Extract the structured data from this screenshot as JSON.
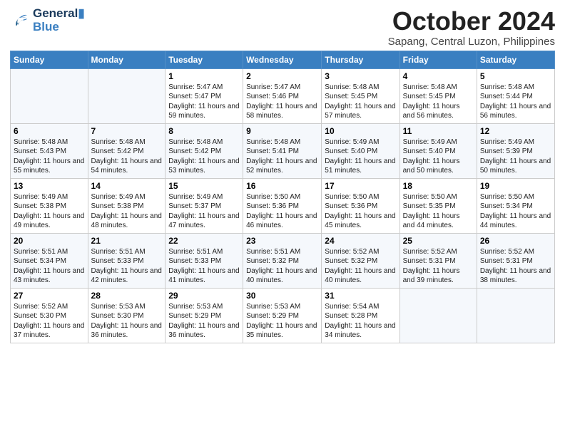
{
  "logo": {
    "line1": "General",
    "line2": "Blue"
  },
  "title": "October 2024",
  "subtitle": "Sapang, Central Luzon, Philippines",
  "headers": [
    "Sunday",
    "Monday",
    "Tuesday",
    "Wednesday",
    "Thursday",
    "Friday",
    "Saturday"
  ],
  "weeks": [
    [
      {
        "day": "",
        "sunrise": "",
        "sunset": "",
        "daylight": ""
      },
      {
        "day": "",
        "sunrise": "",
        "sunset": "",
        "daylight": ""
      },
      {
        "day": "1",
        "sunrise": "Sunrise: 5:47 AM",
        "sunset": "Sunset: 5:47 PM",
        "daylight": "Daylight: 11 hours and 59 minutes."
      },
      {
        "day": "2",
        "sunrise": "Sunrise: 5:47 AM",
        "sunset": "Sunset: 5:46 PM",
        "daylight": "Daylight: 11 hours and 58 minutes."
      },
      {
        "day": "3",
        "sunrise": "Sunrise: 5:48 AM",
        "sunset": "Sunset: 5:45 PM",
        "daylight": "Daylight: 11 hours and 57 minutes."
      },
      {
        "day": "4",
        "sunrise": "Sunrise: 5:48 AM",
        "sunset": "Sunset: 5:45 PM",
        "daylight": "Daylight: 11 hours and 56 minutes."
      },
      {
        "day": "5",
        "sunrise": "Sunrise: 5:48 AM",
        "sunset": "Sunset: 5:44 PM",
        "daylight": "Daylight: 11 hours and 56 minutes."
      }
    ],
    [
      {
        "day": "6",
        "sunrise": "Sunrise: 5:48 AM",
        "sunset": "Sunset: 5:43 PM",
        "daylight": "Daylight: 11 hours and 55 minutes."
      },
      {
        "day": "7",
        "sunrise": "Sunrise: 5:48 AM",
        "sunset": "Sunset: 5:42 PM",
        "daylight": "Daylight: 11 hours and 54 minutes."
      },
      {
        "day": "8",
        "sunrise": "Sunrise: 5:48 AM",
        "sunset": "Sunset: 5:42 PM",
        "daylight": "Daylight: 11 hours and 53 minutes."
      },
      {
        "day": "9",
        "sunrise": "Sunrise: 5:48 AM",
        "sunset": "Sunset: 5:41 PM",
        "daylight": "Daylight: 11 hours and 52 minutes."
      },
      {
        "day": "10",
        "sunrise": "Sunrise: 5:49 AM",
        "sunset": "Sunset: 5:40 PM",
        "daylight": "Daylight: 11 hours and 51 minutes."
      },
      {
        "day": "11",
        "sunrise": "Sunrise: 5:49 AM",
        "sunset": "Sunset: 5:40 PM",
        "daylight": "Daylight: 11 hours and 50 minutes."
      },
      {
        "day": "12",
        "sunrise": "Sunrise: 5:49 AM",
        "sunset": "Sunset: 5:39 PM",
        "daylight": "Daylight: 11 hours and 50 minutes."
      }
    ],
    [
      {
        "day": "13",
        "sunrise": "Sunrise: 5:49 AM",
        "sunset": "Sunset: 5:38 PM",
        "daylight": "Daylight: 11 hours and 49 minutes."
      },
      {
        "day": "14",
        "sunrise": "Sunrise: 5:49 AM",
        "sunset": "Sunset: 5:38 PM",
        "daylight": "Daylight: 11 hours and 48 minutes."
      },
      {
        "day": "15",
        "sunrise": "Sunrise: 5:49 AM",
        "sunset": "Sunset: 5:37 PM",
        "daylight": "Daylight: 11 hours and 47 minutes."
      },
      {
        "day": "16",
        "sunrise": "Sunrise: 5:50 AM",
        "sunset": "Sunset: 5:36 PM",
        "daylight": "Daylight: 11 hours and 46 minutes."
      },
      {
        "day": "17",
        "sunrise": "Sunrise: 5:50 AM",
        "sunset": "Sunset: 5:36 PM",
        "daylight": "Daylight: 11 hours and 45 minutes."
      },
      {
        "day": "18",
        "sunrise": "Sunrise: 5:50 AM",
        "sunset": "Sunset: 5:35 PM",
        "daylight": "Daylight: 11 hours and 44 minutes."
      },
      {
        "day": "19",
        "sunrise": "Sunrise: 5:50 AM",
        "sunset": "Sunset: 5:34 PM",
        "daylight": "Daylight: 11 hours and 44 minutes."
      }
    ],
    [
      {
        "day": "20",
        "sunrise": "Sunrise: 5:51 AM",
        "sunset": "Sunset: 5:34 PM",
        "daylight": "Daylight: 11 hours and 43 minutes."
      },
      {
        "day": "21",
        "sunrise": "Sunrise: 5:51 AM",
        "sunset": "Sunset: 5:33 PM",
        "daylight": "Daylight: 11 hours and 42 minutes."
      },
      {
        "day": "22",
        "sunrise": "Sunrise: 5:51 AM",
        "sunset": "Sunset: 5:33 PM",
        "daylight": "Daylight: 11 hours and 41 minutes."
      },
      {
        "day": "23",
        "sunrise": "Sunrise: 5:51 AM",
        "sunset": "Sunset: 5:32 PM",
        "daylight": "Daylight: 11 hours and 40 minutes."
      },
      {
        "day": "24",
        "sunrise": "Sunrise: 5:52 AM",
        "sunset": "Sunset: 5:32 PM",
        "daylight": "Daylight: 11 hours and 40 minutes."
      },
      {
        "day": "25",
        "sunrise": "Sunrise: 5:52 AM",
        "sunset": "Sunset: 5:31 PM",
        "daylight": "Daylight: 11 hours and 39 minutes."
      },
      {
        "day": "26",
        "sunrise": "Sunrise: 5:52 AM",
        "sunset": "Sunset: 5:31 PM",
        "daylight": "Daylight: 11 hours and 38 minutes."
      }
    ],
    [
      {
        "day": "27",
        "sunrise": "Sunrise: 5:52 AM",
        "sunset": "Sunset: 5:30 PM",
        "daylight": "Daylight: 11 hours and 37 minutes."
      },
      {
        "day": "28",
        "sunrise": "Sunrise: 5:53 AM",
        "sunset": "Sunset: 5:30 PM",
        "daylight": "Daylight: 11 hours and 36 minutes."
      },
      {
        "day": "29",
        "sunrise": "Sunrise: 5:53 AM",
        "sunset": "Sunset: 5:29 PM",
        "daylight": "Daylight: 11 hours and 36 minutes."
      },
      {
        "day": "30",
        "sunrise": "Sunrise: 5:53 AM",
        "sunset": "Sunset: 5:29 PM",
        "daylight": "Daylight: 11 hours and 35 minutes."
      },
      {
        "day": "31",
        "sunrise": "Sunrise: 5:54 AM",
        "sunset": "Sunset: 5:28 PM",
        "daylight": "Daylight: 11 hours and 34 minutes."
      },
      {
        "day": "",
        "sunrise": "",
        "sunset": "",
        "daylight": ""
      },
      {
        "day": "",
        "sunrise": "",
        "sunset": "",
        "daylight": ""
      }
    ]
  ]
}
